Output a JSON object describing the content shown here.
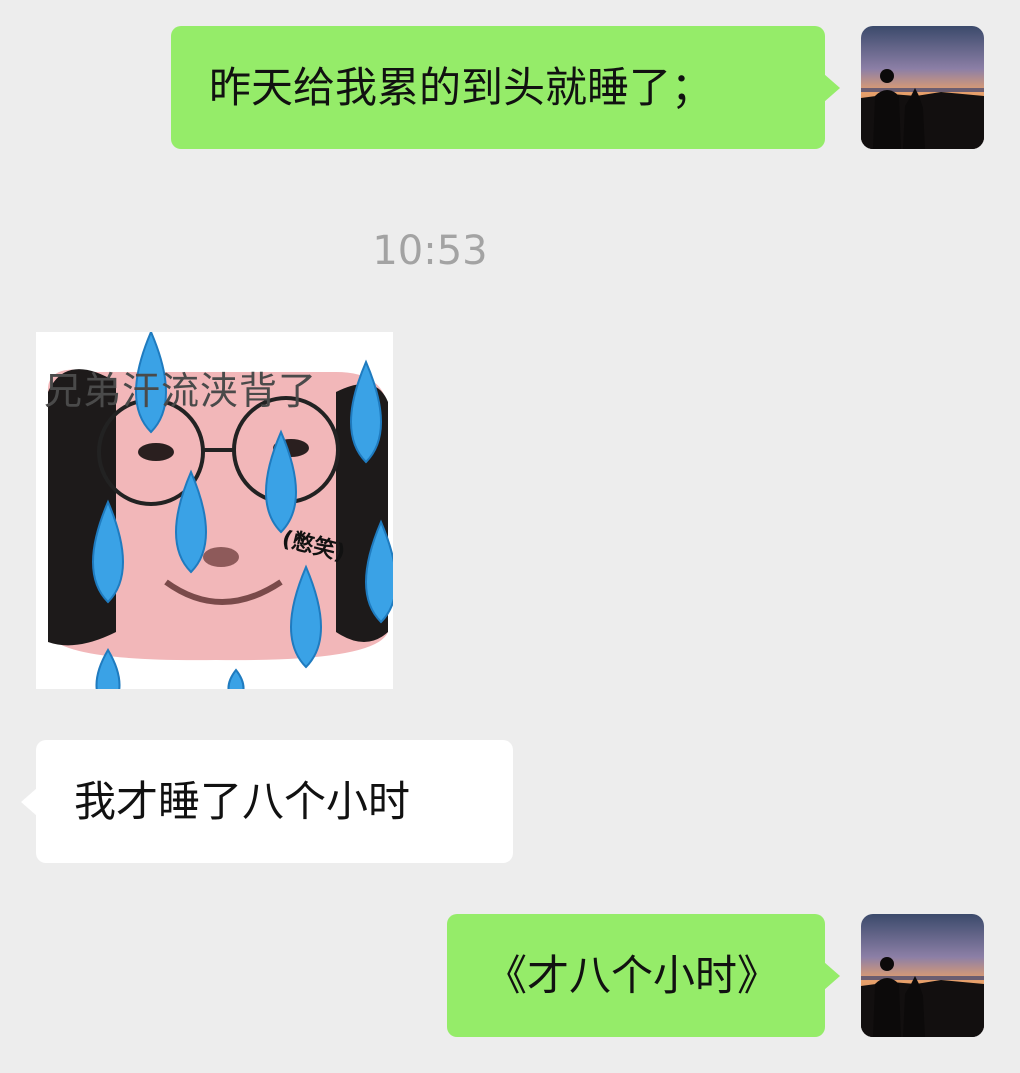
{
  "messages": {
    "msg1": {
      "text": "昨天给我累的到头就睡了；"
    },
    "timestamp": "10:53",
    "sticker": {
      "caption": "兄弟汗流浃背了",
      "tag": "(憋笑)"
    },
    "msg3": {
      "text": "我才睡了八个小时"
    },
    "msg4": {
      "text": "《才八个小时》"
    }
  },
  "colors": {
    "background": "#ededed",
    "outgoing_bubble": "#95ec69",
    "incoming_bubble": "#ffffff",
    "timestamp": "#a3a3a3"
  }
}
